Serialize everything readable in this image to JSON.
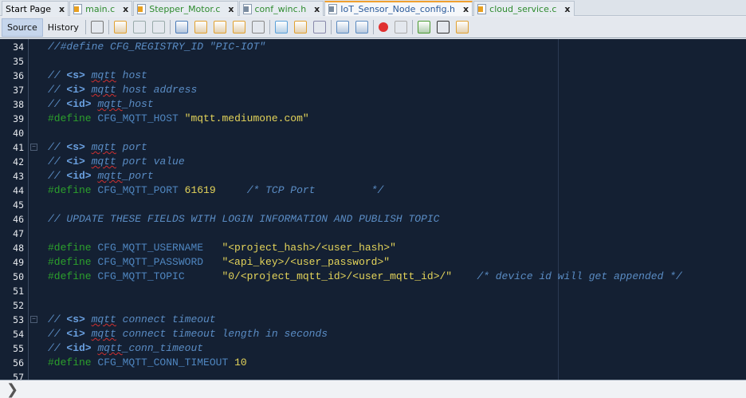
{
  "tabs": [
    {
      "label": "Start Page",
      "icon": "none",
      "active": false
    },
    {
      "label": "main.c",
      "icon": "c-file-icon",
      "active": false
    },
    {
      "label": "Stepper_Motor.c",
      "icon": "c-file-icon",
      "active": false
    },
    {
      "label": "conf_winc.h",
      "icon": "h-file-icon",
      "active": false
    },
    {
      "label": "IoT_Sensor_Node_config.h",
      "icon": "h-file-icon",
      "active": true
    },
    {
      "label": "cloud_service.c",
      "icon": "c-file-icon",
      "active": false
    }
  ],
  "toolbar": {
    "source": "Source",
    "history": "History",
    "icons": [
      "paste-icon",
      "last-edit-icon",
      "back-icon",
      "forward-icon",
      "find-icon",
      "find-previous-icon",
      "find-next-icon",
      "toggle-highlight-icon",
      "select-rectangle-icon",
      "previous-bookmark-icon",
      "next-bookmark-icon",
      "toggle-bookmark-icon",
      "shift-left-icon",
      "shift-right-icon",
      "record-macro-icon",
      "stop-macro-icon",
      "comment-icon",
      "uncomment-icon",
      "header-switch-icon"
    ]
  },
  "colors": {
    "background": "#142033",
    "keyword": "#2ca02c",
    "comment": "#5a8cc4",
    "string": "#e4d45a",
    "identifier": "#4f86c0"
  },
  "lines": [
    {
      "n": "34",
      "t": [
        [
          "c",
          "//#define CFG_REGISTRY_ID \"PIC-IOT\""
        ]
      ]
    },
    {
      "n": "35",
      "t": []
    },
    {
      "n": "36",
      "t": [
        [
          "c",
          "// "
        ],
        [
          "tag",
          "<s>"
        ],
        [
          "c",
          " "
        ],
        [
          "sq",
          "mqtt"
        ],
        [
          "c",
          " host"
        ]
      ]
    },
    {
      "n": "37",
      "t": [
        [
          "c",
          "// "
        ],
        [
          "tag",
          "<i>"
        ],
        [
          "c",
          " "
        ],
        [
          "sq",
          "mqtt"
        ],
        [
          "c",
          " host address"
        ]
      ]
    },
    {
      "n": "38",
      "t": [
        [
          "c",
          "// "
        ],
        [
          "tag",
          "<id>"
        ],
        [
          "c",
          " "
        ],
        [
          "sq",
          "mqtt"
        ],
        [
          "c",
          "_host"
        ]
      ]
    },
    {
      "n": "39",
      "t": [
        [
          "kw",
          "#define"
        ],
        [
          "pl",
          " "
        ],
        [
          "id",
          "CFG_MQTT_HOST"
        ],
        [
          "pl",
          " "
        ],
        [
          "str",
          "\"mqtt.mediumone.com\""
        ]
      ]
    },
    {
      "n": "40",
      "t": []
    },
    {
      "n": "41",
      "fold": true,
      "t": [
        [
          "c",
          "// "
        ],
        [
          "tag",
          "<s>"
        ],
        [
          "c",
          " "
        ],
        [
          "sq",
          "mqtt"
        ],
        [
          "c",
          " port"
        ]
      ]
    },
    {
      "n": "42",
      "t": [
        [
          "c",
          "// "
        ],
        [
          "tag",
          "<i>"
        ],
        [
          "c",
          " "
        ],
        [
          "sq",
          "mqtt"
        ],
        [
          "c",
          " port value"
        ]
      ]
    },
    {
      "n": "43",
      "t": [
        [
          "c",
          "// "
        ],
        [
          "tag",
          "<id>"
        ],
        [
          "c",
          " "
        ],
        [
          "sq",
          "mqtt"
        ],
        [
          "c",
          "_port"
        ]
      ]
    },
    {
      "n": "44",
      "t": [
        [
          "kw",
          "#define"
        ],
        [
          "pl",
          " "
        ],
        [
          "id",
          "CFG_MQTT_PORT"
        ],
        [
          "pl",
          " "
        ],
        [
          "num",
          "61619"
        ],
        [
          "pl",
          "     "
        ],
        [
          "c",
          "/* TCP Port         */"
        ]
      ]
    },
    {
      "n": "45",
      "t": []
    },
    {
      "n": "46",
      "t": [
        [
          "c",
          "// UPDATE THESE FIELDS WITH LOGIN INFORMATION AND PUBLISH TOPIC"
        ]
      ]
    },
    {
      "n": "47",
      "t": []
    },
    {
      "n": "48",
      "t": [
        [
          "kw",
          "#define"
        ],
        [
          "pl",
          " "
        ],
        [
          "id",
          "CFG_MQTT_USERNAME"
        ],
        [
          "pl",
          "   "
        ],
        [
          "str",
          "\"<project_hash>/<user_hash>\""
        ]
      ]
    },
    {
      "n": "49",
      "t": [
        [
          "kw",
          "#define"
        ],
        [
          "pl",
          " "
        ],
        [
          "id",
          "CFG_MQTT_PASSWORD"
        ],
        [
          "pl",
          "   "
        ],
        [
          "str",
          "\"<api_key>/<user_password>\""
        ]
      ]
    },
    {
      "n": "50",
      "t": [
        [
          "kw",
          "#define"
        ],
        [
          "pl",
          " "
        ],
        [
          "id",
          "CFG_MQTT_TOPIC"
        ],
        [
          "pl",
          "      "
        ],
        [
          "str",
          "\"0/<project_mqtt_id>/<user_mqtt_id>/\""
        ],
        [
          "pl",
          "    "
        ],
        [
          "c",
          "/* device id will get appended */"
        ]
      ]
    },
    {
      "n": "51",
      "t": []
    },
    {
      "n": "52",
      "t": []
    },
    {
      "n": "53",
      "fold": true,
      "t": [
        [
          "c",
          "// "
        ],
        [
          "tag",
          "<s>"
        ],
        [
          "c",
          " "
        ],
        [
          "sq",
          "mqtt"
        ],
        [
          "c",
          " connect timeout"
        ]
      ]
    },
    {
      "n": "54",
      "t": [
        [
          "c",
          "// "
        ],
        [
          "tag",
          "<i>"
        ],
        [
          "c",
          " "
        ],
        [
          "sq",
          "mqtt"
        ],
        [
          "c",
          " connect timeout length in seconds"
        ]
      ]
    },
    {
      "n": "55",
      "t": [
        [
          "c",
          "// "
        ],
        [
          "tag",
          "<id>"
        ],
        [
          "c",
          " "
        ],
        [
          "sq",
          "mqtt"
        ],
        [
          "c",
          "_conn_timeout"
        ]
      ]
    },
    {
      "n": "56",
      "t": [
        [
          "kw",
          "#define"
        ],
        [
          "pl",
          " "
        ],
        [
          "id",
          "CFG_MQTT_CONN_TIMEOUT"
        ],
        [
          "pl",
          " "
        ],
        [
          "num",
          "10"
        ]
      ]
    },
    {
      "n": "57",
      "t": []
    }
  ]
}
